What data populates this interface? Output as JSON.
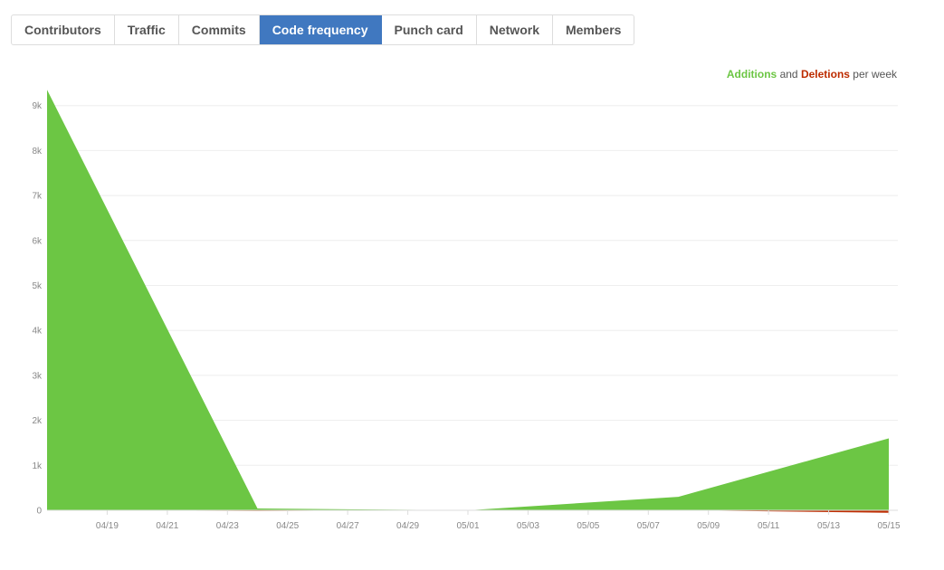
{
  "tabs": [
    {
      "label": "Contributors",
      "active": false
    },
    {
      "label": "Traffic",
      "active": false
    },
    {
      "label": "Commits",
      "active": false
    },
    {
      "label": "Code frequency",
      "active": true
    },
    {
      "label": "Punch card",
      "active": false
    },
    {
      "label": "Network",
      "active": false
    },
    {
      "label": "Members",
      "active": false
    }
  ],
  "legend": {
    "additions": "Additions",
    "and": "and",
    "deletions": "Deletions",
    "per_week": "per week"
  },
  "colors": {
    "additions": "#6cc644",
    "deletions": "#bd2c00",
    "active_tab": "#4078c0",
    "grid": "#eeeeee",
    "axis": "#dddddd"
  },
  "chart_data": {
    "type": "area",
    "title": "",
    "xlabel": "",
    "ylabel": "",
    "xlim": [
      "2017-04-17",
      "2017-05-15"
    ],
    "ylim": [
      0,
      9300
    ],
    "x_ticks": [
      "04/19",
      "04/21",
      "04/23",
      "04/25",
      "04/27",
      "04/29",
      "05/01",
      "05/03",
      "05/05",
      "05/07",
      "05/09",
      "05/11",
      "05/13",
      "05/15"
    ],
    "x_tick_dates": [
      "2017-04-19",
      "2017-04-21",
      "2017-04-23",
      "2017-04-25",
      "2017-04-27",
      "2017-04-29",
      "2017-05-01",
      "2017-05-03",
      "2017-05-05",
      "2017-05-07",
      "2017-05-09",
      "2017-05-11",
      "2017-05-13",
      "2017-05-15"
    ],
    "y_ticks": [
      0,
      1000,
      2000,
      3000,
      4000,
      5000,
      6000,
      7000,
      8000,
      9000
    ],
    "y_tick_labels": [
      "0",
      "1k",
      "2k",
      "3k",
      "4k",
      "5k",
      "6k",
      "7k",
      "8k",
      "9k"
    ],
    "grid": true,
    "legend_position": "top-right",
    "x": [
      "2017-04-17",
      "2017-04-24",
      "2017-05-01",
      "2017-05-08",
      "2017-05-15"
    ],
    "series": [
      {
        "name": "Additions",
        "values": [
          9350,
          40,
          0,
          300,
          1600
        ]
      },
      {
        "name": "Deletions",
        "values": [
          0,
          -30,
          0,
          0,
          -110
        ]
      }
    ]
  }
}
